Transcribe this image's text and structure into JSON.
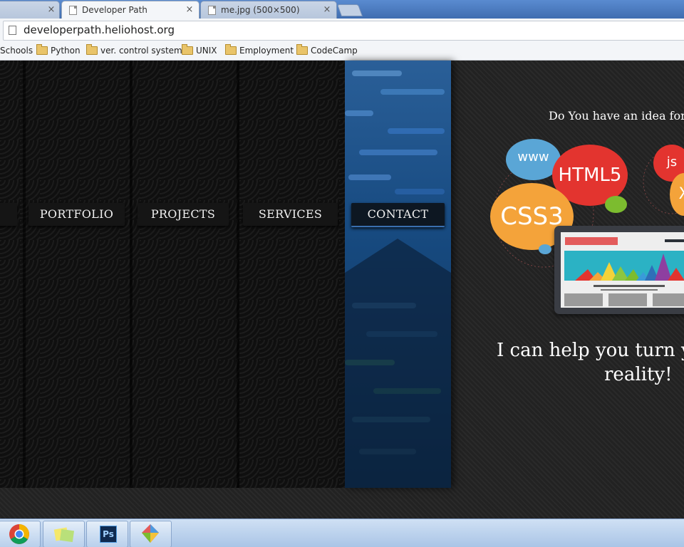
{
  "browser": {
    "tabs": [
      {
        "label": "",
        "close": "×"
      },
      {
        "label": "Developer Path",
        "close": "×"
      },
      {
        "label": "me.jpg (500×500)",
        "close": "×"
      }
    ],
    "url": "developerpath.heliohost.org",
    "bookmarks": [
      "Schools",
      "Python",
      "ver. control system",
      "UNIX",
      "Employment",
      "CodeCamp"
    ]
  },
  "site": {
    "nav": [
      "PORTFOLIO",
      "PROJECTS",
      "SERVICES",
      "CONTACT"
    ],
    "active_nav": "CONTACT",
    "idea_text": "Do You have an idea for w",
    "help_text": "I can help you turn yo",
    "reality_text": "reality!",
    "graphic": {
      "bubbles": [
        "www",
        "HTML5",
        "CSS3",
        "js",
        "X"
      ]
    }
  },
  "taskbar": {
    "apps": [
      "chrome-icon",
      "sticky-notes-icon",
      "photoshop-icon",
      "paint-icon"
    ],
    "ps_label": "Ps"
  },
  "colors": {
    "nav_active": "#0d1722",
    "accent_blue": "#174a80",
    "bubble_www": "#5aa6d6",
    "bubble_html5": "#e3342f",
    "bubble_css3": "#f4a33a",
    "bubble_js": "#e3342f"
  }
}
